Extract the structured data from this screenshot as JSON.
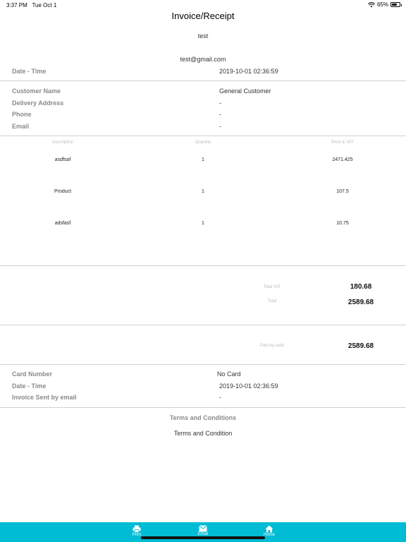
{
  "status_bar": {
    "time": "3:37 PM",
    "date": "Tue Oct 1",
    "battery": "65%",
    "battery_level": 0.65
  },
  "header": {
    "title": "Invoice/Receipt"
  },
  "store": {
    "name": "test",
    "email": "test@gmail.com"
  },
  "datetime": {
    "label": "Date - Time",
    "value": "2019-10-01 02:36:59"
  },
  "customer": {
    "name_label": "Customer Name",
    "name_value": "General Customer",
    "address_label": "Delivery Address",
    "address_value": "-",
    "phone_label": "Phone",
    "phone_value": "-",
    "email_label": "Email",
    "email_value": "-"
  },
  "items_table": {
    "headers": {
      "description": "Description",
      "quantity": "Quantity",
      "price": "Price & VAT"
    },
    "rows": [
      {
        "description": "asdfsaf",
        "quantity": "1",
        "price": "2471.425"
      },
      {
        "description": "Product",
        "quantity": "1",
        "price": "107.5"
      },
      {
        "description": "adsfasf",
        "quantity": "1",
        "price": "10.75"
      }
    ]
  },
  "totals": {
    "vat_label": "Total VAT",
    "vat_value": "180.68",
    "total_label": "Total",
    "total_value": "2589.68",
    "paid_label": "Paid by cash",
    "paid_value": "2589.68"
  },
  "payment": {
    "card_label": "Card Number",
    "card_value": "No Card",
    "date_label": "Date - Time",
    "date_value": "2019-10-01 02:36:59",
    "sent_label": "Invoice Sent by email",
    "sent_value": "-"
  },
  "terms": {
    "heading": "Terms and Conditions",
    "text": "Terms and Condition"
  },
  "tabbar": {
    "color": "#00bcd4",
    "items": [
      {
        "label": "Print",
        "icon": "printer-icon"
      },
      {
        "label": "Email",
        "icon": "mail-icon"
      },
      {
        "label": "Home",
        "icon": "home-icon"
      }
    ]
  }
}
